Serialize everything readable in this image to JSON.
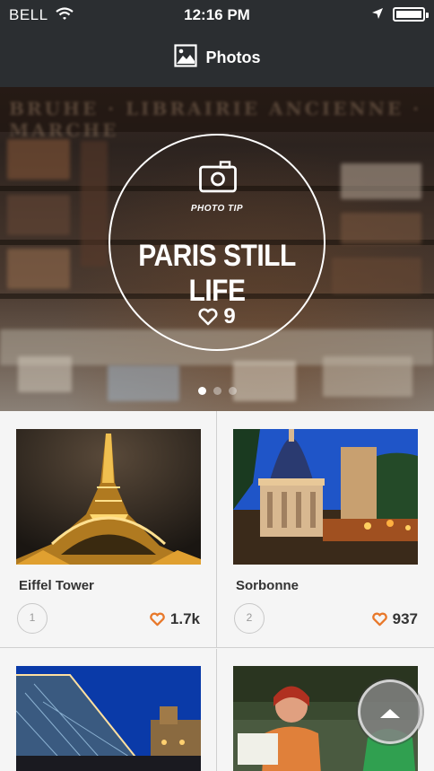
{
  "status_bar": {
    "carrier": "BELL",
    "time": "12:16 PM"
  },
  "nav": {
    "title": "Photos"
  },
  "hero": {
    "label": "PHOTO TIP",
    "title": "PARIS STILL LIFE",
    "likes": "9",
    "page_count": 3,
    "active_page": 1
  },
  "photos": [
    {
      "name": "Eiffel Tower",
      "rank": "1",
      "likes": "1.7k"
    },
    {
      "name": "Sorbonne",
      "rank": "2",
      "likes": "937"
    },
    {
      "name": "",
      "rank": "",
      "likes": ""
    },
    {
      "name": "",
      "rank": "",
      "likes": ""
    }
  ],
  "colors": {
    "accent": "#e8782a",
    "nav_bg": "#2b2e31"
  }
}
